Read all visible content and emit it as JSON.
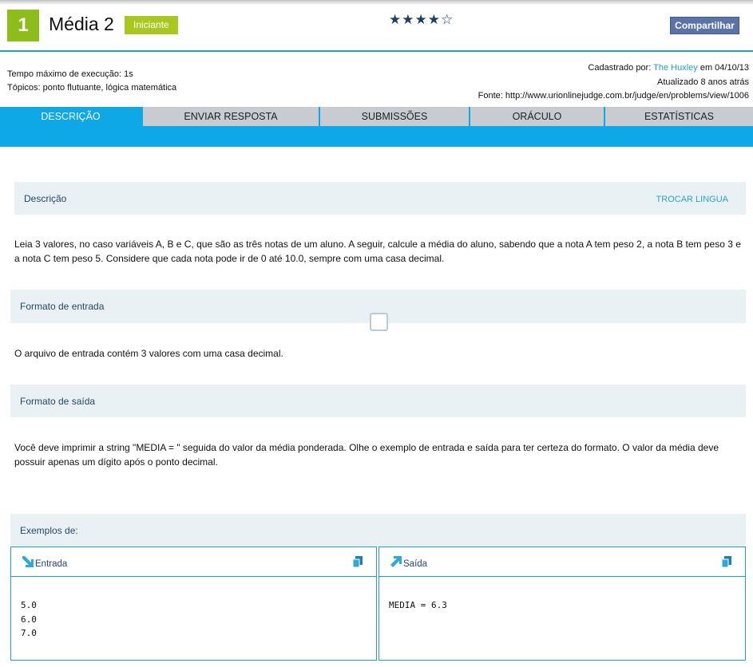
{
  "header": {
    "problem_number": "1",
    "title": "Média 2",
    "level": "Iniciante",
    "rating_stars": "★★★★☆",
    "rating_value": 4,
    "share_label": "Compartilhar"
  },
  "meta": {
    "time_limit": "Tempo máximo de execução: 1s",
    "topics": "Tópicos: ponto flutuante, lógica matemática",
    "registered_prefix": "Cadastrado por:",
    "registered_by": "The Huxley",
    "registered_date": "em 04/10/13",
    "updated": "Atualizado 8 anos atrás",
    "source": "Fonte: http://www.urionlinejudge.com.br/judge/en/problems/view/1006"
  },
  "tabs": [
    "DESCRIÇÃO",
    "ENVIAR RESPOSTA",
    "SUBMISSÕES",
    "ORÁCULO",
    "ESTATÍSTICAS"
  ],
  "description": {
    "heading": "Descrição",
    "swap_language": "TROCAR LINGUA",
    "text": "Leia 3 valores, no caso variáveis A, B e C, que são as três notas de um aluno. A seguir, calcule a média do aluno, sabendo que a nota A tem peso 2, a nota B tem peso 3 e a nota C tem peso 5. Considere que cada nota pode ir de 0 até 10.0, sempre com uma casa decimal."
  },
  "input_format": {
    "heading": "Formato de entrada",
    "text": "O arquivo de entrada contém 3 valores com uma casa decimal."
  },
  "output_format": {
    "heading": "Formato de saída",
    "text": "Você deve imprimir a string \"MEDIA = \" seguida do valor da média ponderada. Olhe o exemplo de entrada e saída para ter certeza do formato. O valor da média deve possuir apenas um dígito após o ponto decimal."
  },
  "examples": {
    "heading": "Exemplos de:",
    "input_title": "Entrada",
    "output_title": "Saída",
    "input_text": "5.0\n6.0\n7.0",
    "output_text": "MEDIA = 6.3"
  },
  "colors": {
    "accent": "#0ea8e6",
    "badge_green": "#8cbd1b",
    "share_blue": "#5b74a8",
    "section_bg": "#e9f1f4"
  }
}
